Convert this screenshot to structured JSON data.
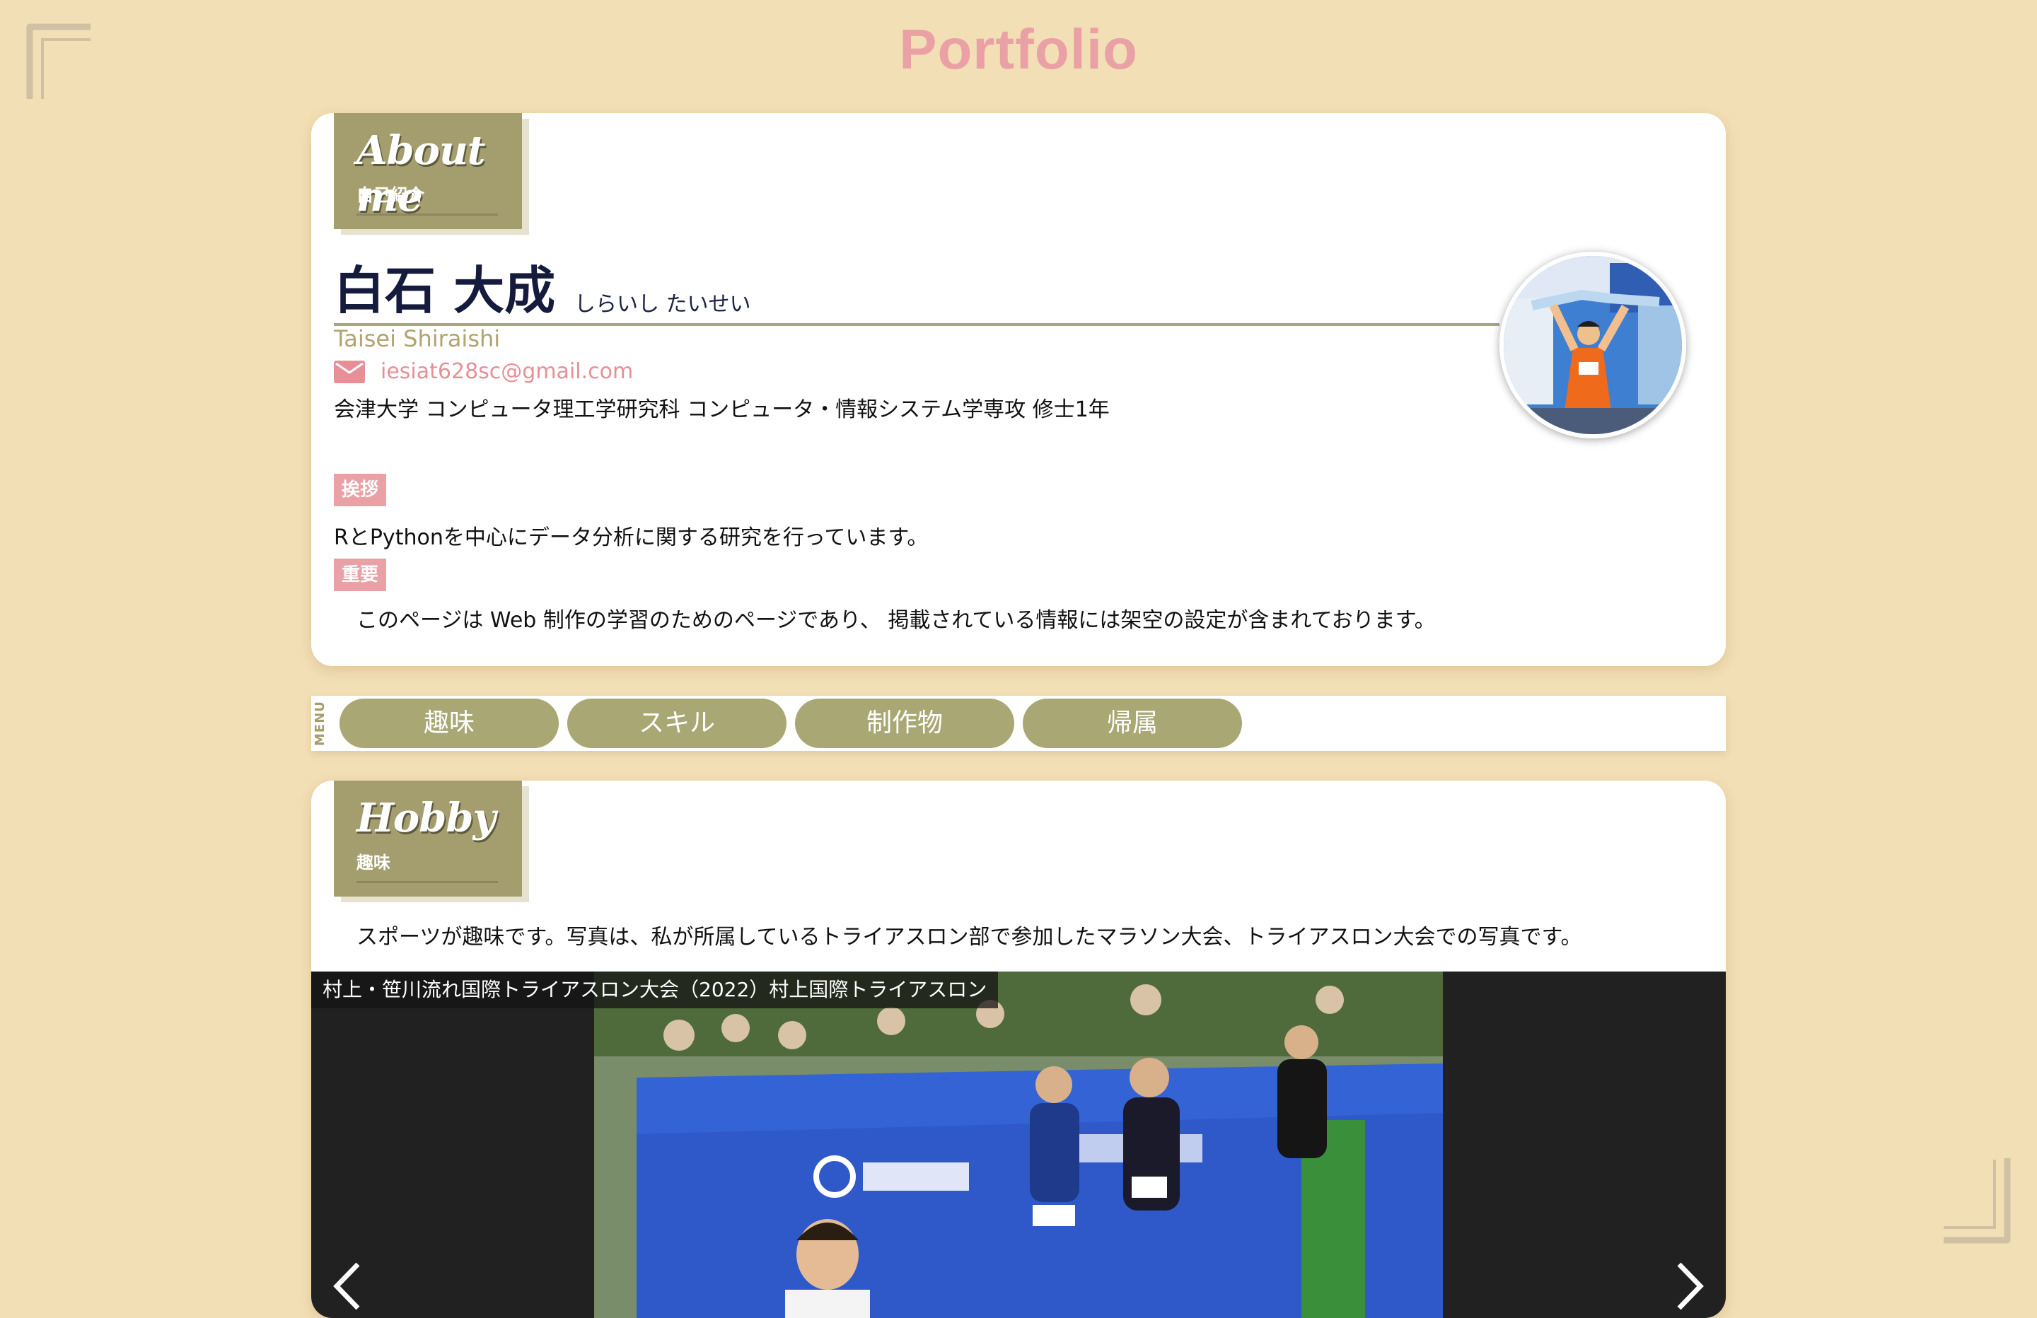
{
  "site": {
    "title": "Portfolio"
  },
  "about": {
    "section_title": "About me",
    "section_sub": "自己紹介",
    "name": "白石 大成",
    "name_kana": "しらいし たいせい",
    "name_en": "Taisei Shiraishi",
    "email": "iesiat628sc@gmail.com",
    "affiliation": "会津大学 コンピュータ理工学研究科 コンピュータ・情報システム学専攻 修士1年",
    "greeting_label": "挨拶",
    "greeting_text": "RとPythonを中心にデータ分析に関する研究を行っています。",
    "note_label": "重要",
    "note_text": "このページは Web 制作の学習のためのページであり、 掲載されている情報には架空の設定が含まれております。"
  },
  "menu": {
    "label": "MENU",
    "items": [
      {
        "label": "趣味"
      },
      {
        "label": "スキル"
      },
      {
        "label": "制作物"
      },
      {
        "label": "帰属"
      }
    ]
  },
  "hobby": {
    "section_title": "Hobby",
    "section_sub": "趣味",
    "description": "スポーツが趣味です。写真は、私が所属しているトライアスロン部で参加したマラソン大会、トライアスロン大会での写真です。",
    "slide_caption": "村上・笹川流れ国際トライアスロン大会（2022）村上国際トライアスロン"
  },
  "icons": [
    "mail-icon",
    "chevron-left-icon",
    "chevron-right-icon",
    "corner-bracket-icon"
  ],
  "colors": {
    "background": "#f3dfb5",
    "title_pink": "#eaa1a6",
    "olive": "#a49e6e",
    "badge_pink": "#e9a1a6",
    "card": "#ffffff"
  }
}
